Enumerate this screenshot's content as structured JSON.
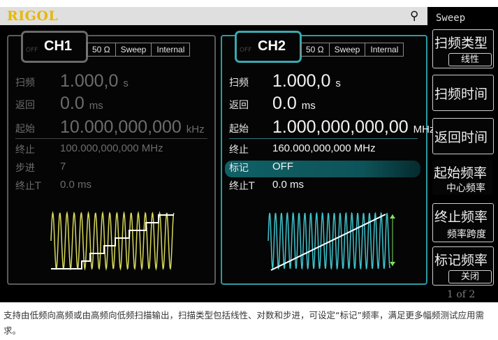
{
  "brand": "RIGOL",
  "usb_icon": "usb-icon",
  "ch1": {
    "name": "CH1",
    "off": "OFF",
    "tags": [
      "50 Ω",
      "Sweep",
      "Internal"
    ],
    "params": [
      {
        "label": "扫频",
        "value": "1.000,0",
        "unit": "s"
      },
      {
        "label": "返回",
        "value": "0.0",
        "unit": "ms"
      },
      {
        "label": "起始",
        "value": "10.000,000,000",
        "unit": "kHz"
      },
      {
        "label": "终止",
        "value": "100.000,000,000 MHz",
        "unit": ""
      },
      {
        "label": "步进",
        "value": "7",
        "unit": ""
      },
      {
        "label": "终止T",
        "value": "0.0 ms",
        "unit": ""
      }
    ],
    "sweep_type": "step"
  },
  "ch2": {
    "name": "CH2",
    "off": "OFF",
    "tags": [
      "50 Ω",
      "Sweep",
      "Internal"
    ],
    "params": [
      {
        "label": "扫频",
        "value": "1.000,0",
        "unit": "s"
      },
      {
        "label": "返回",
        "value": "0.0",
        "unit": "ms"
      },
      {
        "label": "起始",
        "value": "1.000,000,000,00",
        "unit": "MHz"
      },
      {
        "label": "终止",
        "value": "160.000,000,000 MHz",
        "unit": ""
      },
      {
        "label": "标记",
        "value": "OFF",
        "unit": ""
      },
      {
        "label": "终止T",
        "value": "0.0 ms",
        "unit": ""
      }
    ],
    "sweep_type": "linear"
  },
  "softkeys": {
    "header": "Sweep",
    "sweep_type": {
      "label": "扫频类型",
      "option": "线性"
    },
    "sweep_time": {
      "label": "扫频时间"
    },
    "return_time": {
      "label": "返回时间"
    },
    "start_freq": {
      "label": "起始频率",
      "alt": "中心频率"
    },
    "stop_freq": {
      "label": "终止频率",
      "alt": "频率跨度"
    },
    "marker_freq": {
      "label": "标记频率",
      "option": "关闭"
    },
    "page": "1 of 2"
  },
  "colors": {
    "ch1_wave": "#d8d85a",
    "ch2_wave": "#3fc2cc",
    "brand": "#e8b800"
  },
  "caption": "支持由低频向高频或由高频向低频扫描输出，扫描类型包括线性、对数和步进，可设定“标记”频率，满足更多幅频测试应用需求。"
}
